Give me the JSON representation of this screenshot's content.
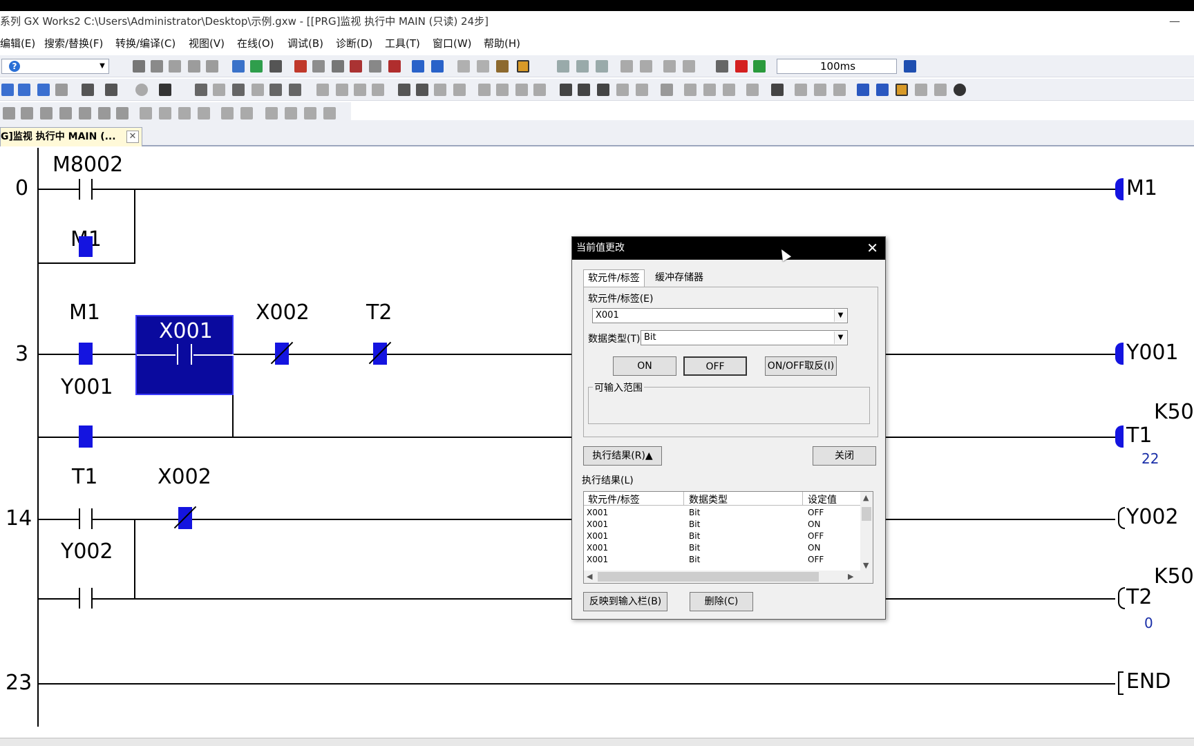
{
  "window": {
    "title": "系列 GX Works2 C:\\Users\\Administrator\\Desktop\\示例.gxw - [[PRG]监视 执行中 MAIN (只读) 24步]",
    "minimize": "—"
  },
  "menu": [
    "编辑(E)",
    "搜索/替换(F)",
    "转换/编译(C)",
    "视图(V)",
    "在线(O)",
    "调试(B)",
    "诊断(D)",
    "工具(T)",
    "窗口(W)",
    "帮助(H)"
  ],
  "toolbar": {
    "help_icon": "?",
    "interval": "100ms"
  },
  "tab": {
    "label": "G]监视 执行中 MAIN (...",
    "close": "✕"
  },
  "ladder": {
    "steps": [
      "0",
      "3",
      "14",
      "23"
    ],
    "contacts": {
      "m8002": "M8002",
      "m1_parallel": "M1",
      "m1": "M1",
      "x001": "X001",
      "x002_a": "X002",
      "t2": "T2",
      "y001": "Y001",
      "t1": "T1",
      "x002_b": "X002",
      "y002": "Y002"
    },
    "coils": {
      "m1": "M1",
      "y001": "Y001",
      "t1_k": "K50",
      "t1": "T1",
      "t1_val": "22",
      "y002": "Y002",
      "t2_k": "K50",
      "t2": "T2",
      "t2_val": "0",
      "end": "END"
    }
  },
  "dialog": {
    "title": "当前值更改",
    "close": "✕",
    "tab_device": "软元件/标签",
    "tab_buffer": "缓冲存储器",
    "device_label": "软元件/标签(E)",
    "device_value": "X001",
    "datatype_label": "数据类型(T)",
    "datatype_value": "Bit",
    "btn_on": "ON",
    "btn_off": "OFF",
    "btn_toggle": "ON/OFF取反(I)",
    "range_label": "可输入范围",
    "btn_result": "执行结果(R)▲",
    "btn_close": "关闭",
    "result_label": "执行结果(L)",
    "columns": [
      "软元件/标签",
      "数据类型",
      "设定值"
    ],
    "rows": [
      [
        "X001",
        "Bit",
        "OFF"
      ],
      [
        "X001",
        "Bit",
        "ON"
      ],
      [
        "X001",
        "Bit",
        "OFF"
      ],
      [
        "X001",
        "Bit",
        "ON"
      ],
      [
        "X001",
        "Bit",
        "OFF"
      ]
    ],
    "btn_reflect": "反映到输入栏(B)",
    "btn_delete": "删除(C)"
  }
}
